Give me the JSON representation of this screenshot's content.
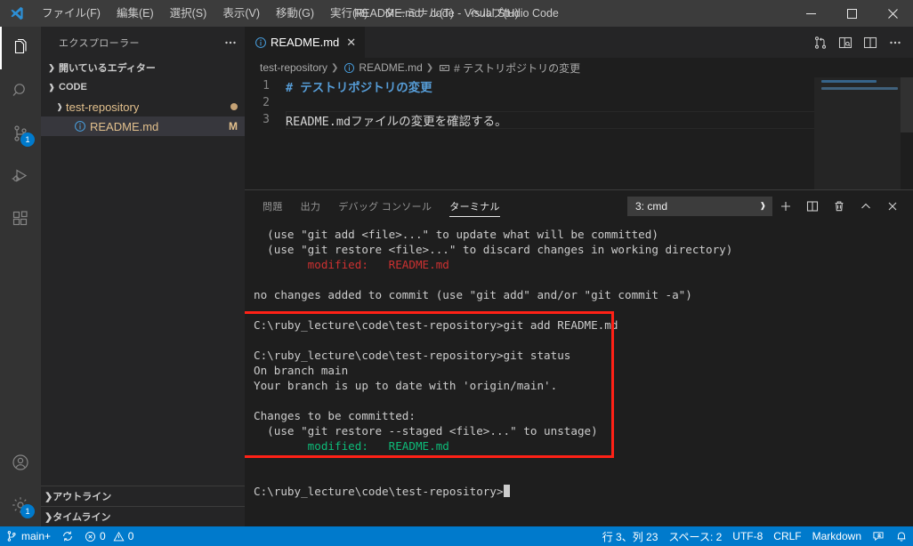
{
  "window": {
    "title": "README.md - code - Visual Studio Code",
    "minimize": "—",
    "maximize": "☐",
    "close": "✕"
  },
  "menu": {
    "items": [
      {
        "label": "ファイル(F)"
      },
      {
        "label": "編集(E)"
      },
      {
        "label": "選択(S)"
      },
      {
        "label": "表示(V)"
      },
      {
        "label": "移動(G)"
      },
      {
        "label": "実行(R)"
      },
      {
        "label": "ターミナル(T)"
      },
      {
        "label": "ヘルプ(H)"
      }
    ]
  },
  "activitybar": {
    "items": [
      {
        "name": "explorer",
        "badge": ""
      },
      {
        "name": "search",
        "badge": ""
      },
      {
        "name": "source-control",
        "badge": "1"
      },
      {
        "name": "run-and-debug",
        "badge": ""
      },
      {
        "name": "extensions",
        "badge": ""
      }
    ],
    "bottom": [
      {
        "name": "accounts",
        "badge": ""
      },
      {
        "name": "settings",
        "badge": "1"
      }
    ]
  },
  "sidebar": {
    "title": "エクスプローラー",
    "open_editors": "開いているエディター",
    "workspace": "CODE",
    "tree": [
      {
        "label": "test-repository",
        "indent": 1,
        "dirty": true,
        "deco": "",
        "selected": false,
        "type": "folder"
      },
      {
        "label": "README.md",
        "indent": 2,
        "dirty": false,
        "deco": "M",
        "selected": true,
        "type": "file"
      }
    ],
    "bottom_sections": [
      {
        "label": "アウトライン"
      },
      {
        "label": "タイムライン"
      }
    ]
  },
  "editor": {
    "tab": {
      "label": "README.md",
      "close": "✕"
    },
    "actions": [
      "compare-changes-icon",
      "open-preview-to-side-icon",
      "split-editor-icon",
      "more-actions-icon"
    ],
    "breadcrumbs": [
      {
        "label": "test-repository",
        "icon": ""
      },
      {
        "label": "README.md",
        "icon": "file-info-icon"
      },
      {
        "label": "# テストリポジトリの変更",
        "icon": "symbol-string-icon"
      }
    ],
    "lines": [
      {
        "num": "1",
        "text": "# テストリポジトリの変更",
        "style": "heading",
        "current": false
      },
      {
        "num": "2",
        "text": "",
        "style": "text",
        "current": false
      },
      {
        "num": "3",
        "text": "README.mdファイルの変更を確認する。",
        "style": "text",
        "current": true
      }
    ]
  },
  "panel": {
    "tabs": [
      {
        "label": "問題",
        "active": false
      },
      {
        "label": "出力",
        "active": false
      },
      {
        "label": "デバッグ コンソール",
        "active": false
      },
      {
        "label": "ターミナル",
        "active": true
      }
    ],
    "terminal_select": "3: cmd",
    "actions": [
      "new-terminal-icon",
      "split-terminal-icon",
      "kill-terminal-icon",
      "maximize-panel-icon",
      "close-panel-icon"
    ],
    "terminal_lines": [
      {
        "text": "  (use \"git add <file>...\" to update what will be committed)",
        "color": "default"
      },
      {
        "text": "  (use \"git restore <file>...\" to discard changes in working directory)",
        "color": "default"
      },
      {
        "text": "        modified:   README.md",
        "color": "red"
      },
      {
        "text": "",
        "color": "default"
      },
      {
        "text": "no changes added to commit (use \"git add\" and/or \"git commit -a\")",
        "color": "default"
      },
      {
        "text": "",
        "color": "default"
      },
      {
        "text": "C:\\ruby_lecture\\code\\test-repository>git add README.md",
        "color": "default"
      },
      {
        "text": "",
        "color": "default"
      },
      {
        "text": "C:\\ruby_lecture\\code\\test-repository>git status",
        "color": "default"
      },
      {
        "text": "On branch main",
        "color": "default"
      },
      {
        "text": "Your branch is up to date with 'origin/main'.",
        "color": "default"
      },
      {
        "text": "",
        "color": "default"
      },
      {
        "text": "Changes to be committed:",
        "color": "default"
      },
      {
        "text": "  (use \"git restore --staged <file>...\" to unstage)",
        "color": "default"
      },
      {
        "text": "        modified:   README.md",
        "color": "green"
      },
      {
        "text": "",
        "color": "default"
      },
      {
        "text": "",
        "color": "default"
      },
      {
        "text": "C:\\ruby_lecture\\code\\test-repository>",
        "color": "default",
        "cursor": true
      }
    ],
    "highlight_color": "#ff2116"
  },
  "statusbar": {
    "branch": "main+",
    "errors": "0",
    "warnings": "0",
    "cursor_position": "行 3、列 23",
    "indentation": "スペース: 2",
    "encoding": "UTF-8",
    "eol": "CRLF",
    "language": "Markdown",
    "accent": "#007acc"
  }
}
